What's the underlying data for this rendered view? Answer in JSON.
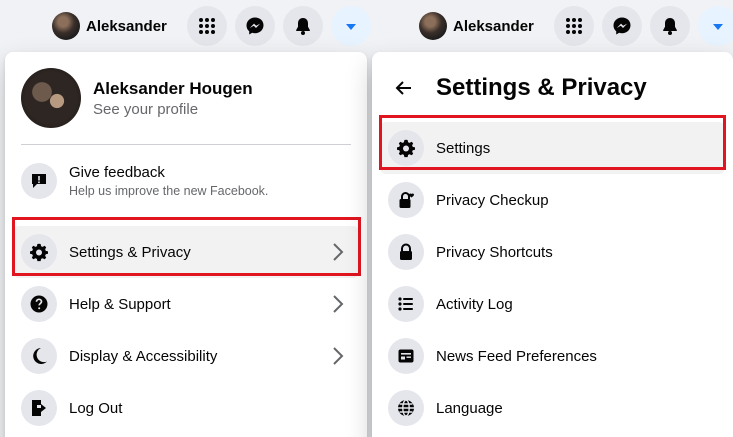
{
  "topbar": {
    "user_name": "Aleksander"
  },
  "account_menu": {
    "profile_name": "Aleksander Hougen",
    "profile_sub": "See your profile",
    "feedback": {
      "label": "Give feedback",
      "sub": "Help us improve the new Facebook."
    },
    "items": [
      {
        "label": "Settings & Privacy",
        "icon": "gear-icon"
      },
      {
        "label": "Help & Support",
        "icon": "question-icon"
      },
      {
        "label": "Display & Accessibility",
        "icon": "moon-icon"
      },
      {
        "label": "Log Out",
        "icon": "logout-icon"
      }
    ]
  },
  "settings_menu": {
    "title": "Settings & Privacy",
    "items": [
      {
        "label": "Settings",
        "icon": "gear-icon"
      },
      {
        "label": "Privacy Checkup",
        "icon": "lock-heart-icon"
      },
      {
        "label": "Privacy Shortcuts",
        "icon": "lock-icon"
      },
      {
        "label": "Activity Log",
        "icon": "list-icon"
      },
      {
        "label": "News Feed Preferences",
        "icon": "feed-icon"
      },
      {
        "label": "Language",
        "icon": "globe-icon"
      }
    ]
  },
  "colors": {
    "highlight": "#e0151f",
    "accent": "#1877f2"
  }
}
